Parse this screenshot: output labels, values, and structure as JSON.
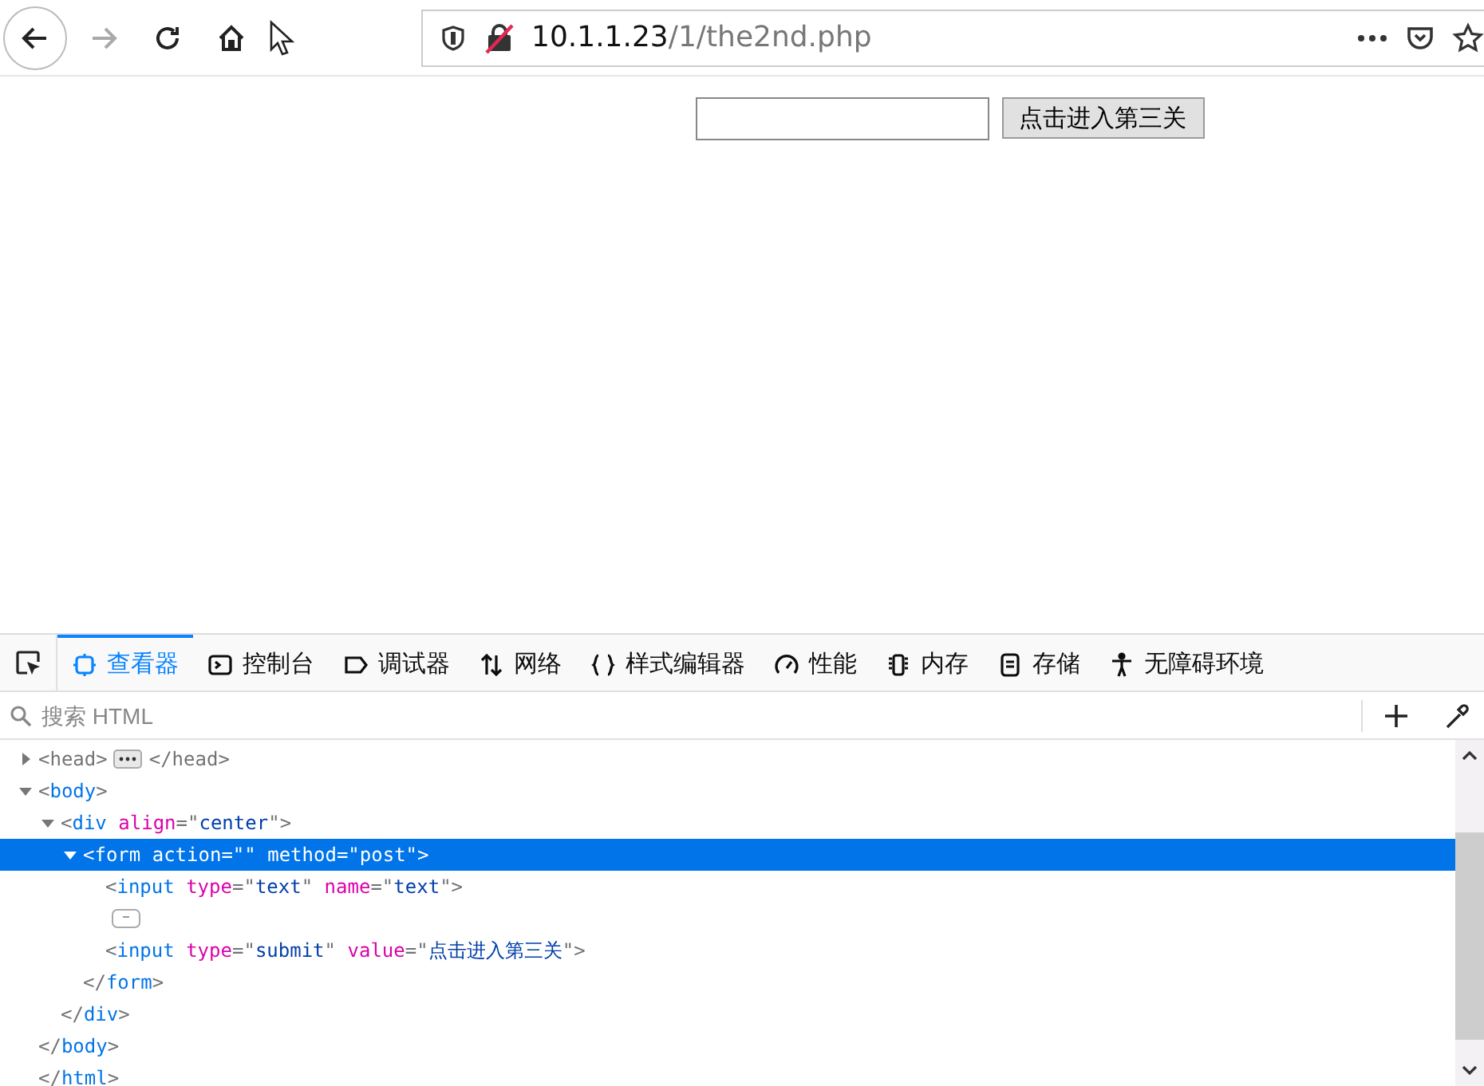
{
  "browser": {
    "url_host": "10.1.1.23",
    "url_path": "/1/the2nd.php",
    "forward_disabled": true
  },
  "page": {
    "submit_label": "点击进入第三关"
  },
  "devtools": {
    "tabs": [
      {
        "label": "查看器",
        "kind": "inspector",
        "selected": true
      },
      {
        "label": "控制台",
        "kind": "console",
        "selected": false
      },
      {
        "label": "调试器",
        "kind": "debugger",
        "selected": false
      },
      {
        "label": "网络",
        "kind": "network",
        "selected": false
      },
      {
        "label": "样式编辑器",
        "kind": "style",
        "selected": false
      },
      {
        "label": "性能",
        "kind": "performance",
        "selected": false
      },
      {
        "label": "内存",
        "kind": "memory",
        "selected": false
      },
      {
        "label": "存储",
        "kind": "storage",
        "selected": false
      },
      {
        "label": "无障碍环境",
        "kind": "accessibility",
        "selected": false
      }
    ],
    "search": {
      "placeholder": "搜索 HTML"
    },
    "tree": [
      {
        "kind": "element",
        "expanded": false,
        "selected": false,
        "open": [
          {
            "kind": "punct",
            "text": "<head>"
          }
        ],
        "close": [
          {
            "kind": "punct",
            "text": "</head>"
          }
        ]
      },
      {
        "kind": "element",
        "expanded": true,
        "selected": false,
        "open": [
          {
            "kind": "punct",
            "text": "<"
          },
          {
            "kind": "tag",
            "text": "body"
          },
          {
            "kind": "punct",
            "text": ">"
          }
        ],
        "close": [
          {
            "kind": "punct",
            "text": "</"
          },
          {
            "kind": "tag",
            "text": "body"
          },
          {
            "kind": "punct",
            "text": ">"
          }
        ],
        "children": [
          {
            "kind": "element",
            "expanded": true,
            "selected": false,
            "open": [
              {
                "kind": "punct",
                "text": "<"
              },
              {
                "kind": "tag",
                "text": "div"
              },
              {
                "kind": "attr",
                "text": " align"
              },
              {
                "kind": "punct",
                "text": "=\""
              },
              {
                "kind": "value",
                "text": "center"
              },
              {
                "kind": "punct",
                "text": "\">"
              }
            ],
            "close": [
              {
                "kind": "punct",
                "text": "</"
              },
              {
                "kind": "tag",
                "text": "div"
              },
              {
                "kind": "punct",
                "text": ">"
              }
            ],
            "children": [
              {
                "kind": "element",
                "expanded": true,
                "selected": true,
                "open_text": "<form action=\"\" method=\"post\">",
                "close": [
                  {
                    "kind": "punct",
                    "text": "</"
                  },
                  {
                    "kind": "tag",
                    "text": "form"
                  },
                  {
                    "kind": "punct",
                    "text": ">"
                  }
                ],
                "children": [
                  {
                    "kind": "leaf",
                    "open": [
                      {
                        "kind": "punct",
                        "text": "<"
                      },
                      {
                        "kind": "tag",
                        "text": "input"
                      },
                      {
                        "kind": "attr",
                        "text": " type"
                      },
                      {
                        "kind": "punct",
                        "text": "=\""
                      },
                      {
                        "kind": "value",
                        "text": "text"
                      },
                      {
                        "kind": "punct",
                        "text": "\""
                      },
                      {
                        "kind": "attr",
                        "text": " name"
                      },
                      {
                        "kind": "punct",
                        "text": "=\""
                      },
                      {
                        "kind": "value",
                        "text": "text"
                      },
                      {
                        "kind": "punct",
                        "text": "\">"
                      }
                    ]
                  },
                  {
                    "kind": "whitespace"
                  },
                  {
                    "kind": "leaf",
                    "open": [
                      {
                        "kind": "punct",
                        "text": "<"
                      },
                      {
                        "kind": "tag",
                        "text": "input"
                      },
                      {
                        "kind": "attr",
                        "text": " type"
                      },
                      {
                        "kind": "punct",
                        "text": "=\""
                      },
                      {
                        "kind": "value",
                        "text": "submit"
                      },
                      {
                        "kind": "punct",
                        "text": "\""
                      },
                      {
                        "kind": "attr",
                        "text": " value"
                      },
                      {
                        "kind": "punct",
                        "text": "=\""
                      },
                      {
                        "kind": "value",
                        "text": "点击进入第三关"
                      },
                      {
                        "kind": "punct",
                        "text": "\">"
                      }
                    ]
                  }
                ]
              }
            ]
          }
        ]
      },
      {
        "kind": "closing",
        "open": [
          {
            "kind": "punct",
            "text": "</"
          },
          {
            "kind": "tag",
            "text": "html"
          },
          {
            "kind": "punct",
            "text": ">"
          }
        ]
      }
    ]
  }
}
